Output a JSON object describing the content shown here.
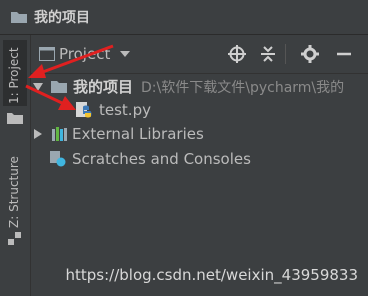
{
  "window": {
    "title": "我的项目"
  },
  "side_tabs": {
    "project": "1: Project",
    "structure": "Z: Structure"
  },
  "toolbar": {
    "project_view": "Project",
    "icons": [
      "target-icon",
      "collapse-all-icon",
      "gear-icon",
      "minimize-icon"
    ]
  },
  "tree": {
    "root": {
      "name": "我的项目",
      "path": "D:\\软件下载文件\\pycharm\\我的"
    },
    "file": {
      "name": "test.py"
    },
    "external": {
      "name": "External Libraries"
    },
    "scratches": {
      "name": "Scratches and Consoles"
    }
  },
  "watermark": "https://blog.csdn.net/weixin_43959833",
  "colors": {
    "background": "#3c3f41",
    "annotation_arrow": "#e02020",
    "text": "#bbbbbb"
  }
}
